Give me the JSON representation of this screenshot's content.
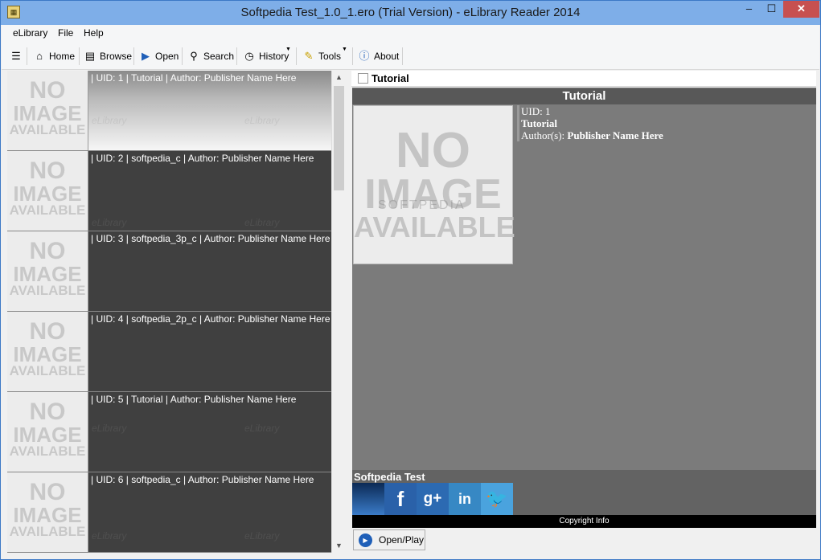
{
  "window": {
    "title": "Softpedia Test_1.0_1.ero (Trial Version) - eLibrary Reader 2014",
    "minimize": "–",
    "maximize": "☐",
    "close": "✕"
  },
  "menu": [
    "eLibrary",
    "File",
    "Help"
  ],
  "toolbar": {
    "home": "Home",
    "browse": "Browse",
    "open": "Open",
    "search": "Search",
    "history": "History",
    "tools": "Tools",
    "about": "About"
  },
  "placeholder_image": {
    "line1": "NO",
    "line2": "IMAGE",
    "line3": "AVAILABLE"
  },
  "watermark": "eLibrary",
  "list": [
    {
      "text": "| UID:  1 | Tutorial | Author: Publisher Name Here"
    },
    {
      "text": "| UID:  2 | softpedia_c | Author: Publisher Name Here"
    },
    {
      "text": "| UID:  3 | softpedia_3p_c | Author: Publisher Name Here"
    },
    {
      "text": "| UID:  4 | softpedia_2p_c | Author: Publisher Name Here"
    },
    {
      "text": "| UID:  5 | Tutorial | Author: Publisher Name Here"
    },
    {
      "text": "| UID:  6 | softpedia_c | Author: Publisher Name Here"
    }
  ],
  "detail": {
    "header_title": "Tutorial",
    "title": "Tutorial",
    "softpedia_watermark": "SOFTPEDIA",
    "uid": "UID: 1",
    "name": "Tutorial",
    "author_label": "Author(s):",
    "author": "Publisher Name Here",
    "publisher": "Softpedia Test",
    "social": {
      "facebook": "f",
      "googleplus": "g+",
      "linkedin": "in",
      "twitter": "🐦"
    },
    "copyright": "Copyright Info",
    "open_play": "Open/Play"
  },
  "colors": {
    "list_bg": "#404040",
    "detail_bg": "#7b7b7b",
    "accent": "#1f5fb8"
  }
}
